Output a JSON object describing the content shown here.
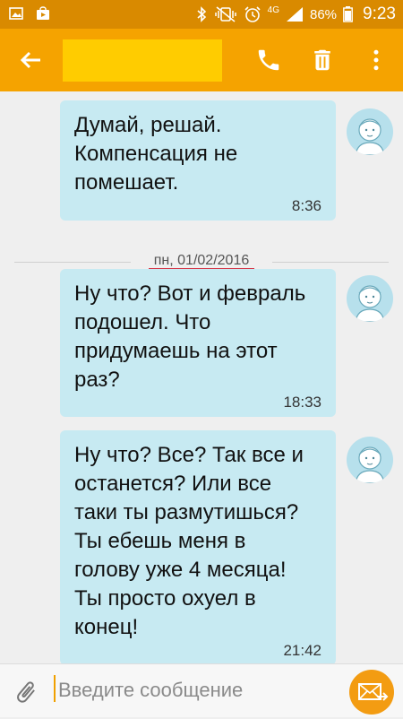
{
  "status_bar": {
    "network": "4G",
    "battery": "86%",
    "time": "9:23",
    "left_icons": [
      "gallery-notification-icon",
      "shopping-bag-notification-icon"
    ],
    "right_icons": [
      "bluetooth-icon",
      "vibrate-mute-icon",
      "alarm-icon",
      "signal-icon"
    ]
  },
  "toolbar": {
    "colors": {
      "bar": "#f5a300",
      "name_redaction": "#ffcc00"
    },
    "icons": [
      "back-arrow-icon",
      "phone-icon",
      "trash-icon",
      "more-vertical-icon"
    ]
  },
  "conversation": {
    "messages": [
      {
        "text": "Думай, решай.\nКомпенсация не\nпомешает.",
        "time": "8:36"
      },
      {
        "text": "Ну что? Вот и февраль\nподошел. Что\nпридумаешь на этот\nраз?",
        "time": "18:33"
      },
      {
        "text": "Ну что? Все? Так все и\nостанется? Или все\nтаки ты размутишься?\nТы ебешь меня в\nголову уже 4 месяца!\nТы просто охуел в\nконец!",
        "time": "21:42"
      }
    ],
    "date_separator": "пн, 01/02/2016",
    "bubble_color": "#c7eaf2"
  },
  "composer": {
    "placeholder": "Введите сообщение",
    "send_color": "#f39c12"
  }
}
